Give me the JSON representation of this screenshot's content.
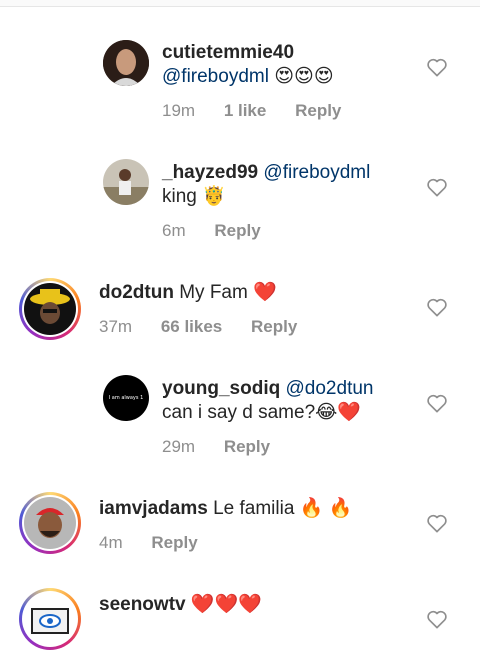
{
  "comments": [
    {
      "username": "cutietemmie40",
      "mention": "@fireboydml",
      "text": "",
      "emoji": "😍😍😍",
      "time": "19m",
      "likes": "1 like",
      "reply": "Reply"
    },
    {
      "username": "_hayzed99",
      "mention": "@fireboydml",
      "text": "king",
      "emoji": "🤴",
      "time": "6m",
      "likes": "",
      "reply": "Reply"
    },
    {
      "username": "do2dtun",
      "mention": "",
      "text": "My Fam",
      "emoji": "❤️",
      "time": "37m",
      "likes": "66 likes",
      "reply": "Reply"
    },
    {
      "username": "young_sodiq",
      "mention": "@do2dtun",
      "text": "can i say d same?",
      "emoji": "😂❤️",
      "time": "29m",
      "likes": "",
      "reply": "Reply",
      "avatar_text": "I am always 1"
    },
    {
      "username": "iamvjadams",
      "mention": "",
      "text": "Le familia",
      "emoji": "🔥 🔥",
      "time": "4m",
      "likes": "",
      "reply": "Reply"
    },
    {
      "username": "seenowtv",
      "mention": "",
      "text": "",
      "emoji": "❤️❤️❤️",
      "time": "",
      "likes": "",
      "reply": ""
    }
  ],
  "colors": {
    "mention": "#003569",
    "meta": "#8e8e8e",
    "heart_outline": "#8e8e8e"
  },
  "icons": {
    "like": "heart-outline-icon"
  }
}
